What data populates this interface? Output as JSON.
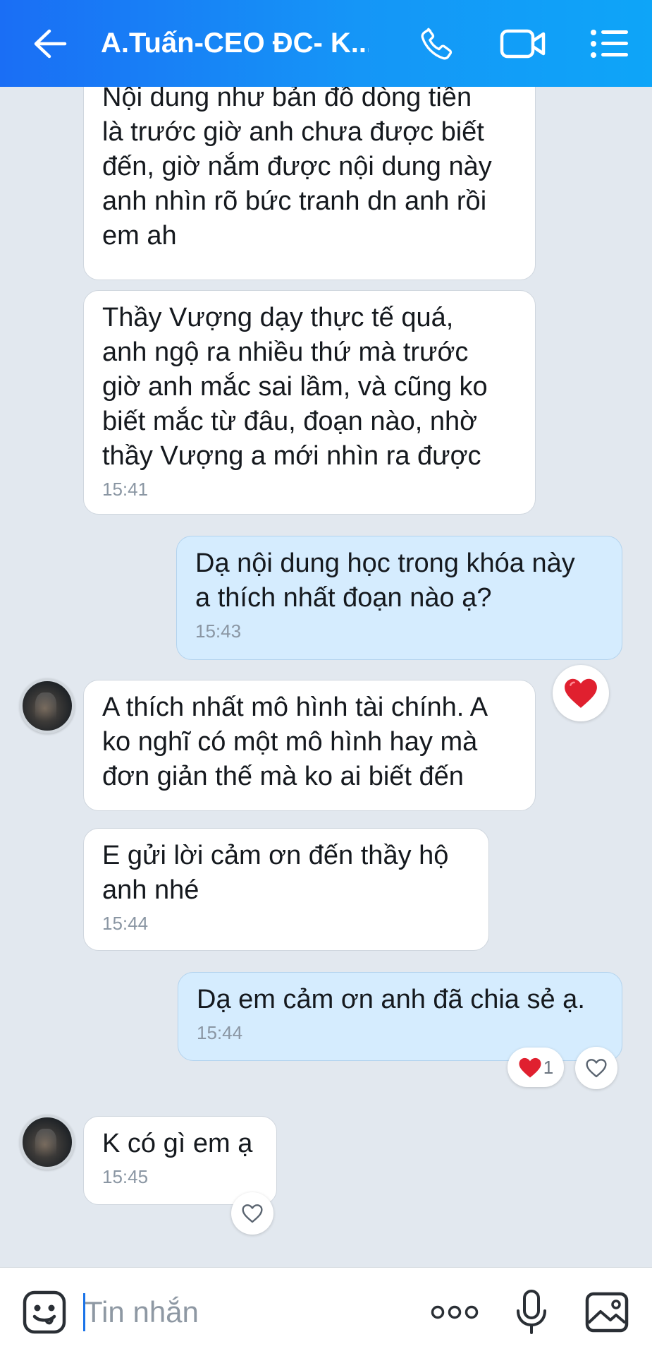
{
  "header": {
    "back_icon": "arrow-left-icon",
    "title": "A.Tuấn-CEO ĐC- K...",
    "call_icon": "phone-icon",
    "video_icon": "video-camera-icon",
    "menu_icon": "list-menu-icon"
  },
  "messages": [
    {
      "dir": "in",
      "text": "Nội dung như bản đồ dòng tiền\nlà trước giờ anh chưa được biết\nđến, giờ nắm được nội dung này\nanh nhìn rõ bức tranh dn anh rồi\nem ah",
      "time": ""
    },
    {
      "dir": "in",
      "text": "Thầy Vượng dạy thực tế quá,\nanh ngộ ra nhiều thứ mà trước\ngiờ anh mắc sai lầm, và cũng ko\nbiết mắc từ đâu, đoạn nào, nhờ\nthầy Vượng a mới nhìn ra được",
      "time": "15:41"
    },
    {
      "dir": "out",
      "text": "Dạ nội dung học trong khóa này\na thích nhất đoạn nào ạ?",
      "time": "15:43"
    },
    {
      "dir": "in",
      "text": "A thích nhất mô hình tài chính. A\nko nghĩ có một mô hình hay mà\nđơn giản thế mà ko ai biết đến",
      "time": ""
    },
    {
      "dir": "in",
      "text": "E gửi lời cảm ơn đến thầy hộ\nanh nhé",
      "time": "15:44"
    },
    {
      "dir": "out",
      "text": "Dạ em cảm ơn anh đã chia sẻ ạ.",
      "time": "15:44"
    },
    {
      "dir": "in",
      "text": "K có gì em ạ",
      "time": "15:45"
    }
  ],
  "reactions": {
    "heart_reaction_count": "1",
    "heart_icon": "red-heart-icon",
    "like_icon": "heart-outline-icon"
  },
  "input": {
    "placeholder": "Tin nhắn",
    "emoji_icon": "sticker-face-icon",
    "more_icon": "more-dots-icon",
    "mic_icon": "microphone-icon",
    "photo_icon": "image-icon"
  },
  "colors": {
    "header_start": "#1a6ef5",
    "header_end": "#0ea5f8",
    "background": "#e2e8ef",
    "incoming_bubble": "#ffffff",
    "outgoing_bubble": "#d5ecfe",
    "heart": "#e0202f"
  }
}
